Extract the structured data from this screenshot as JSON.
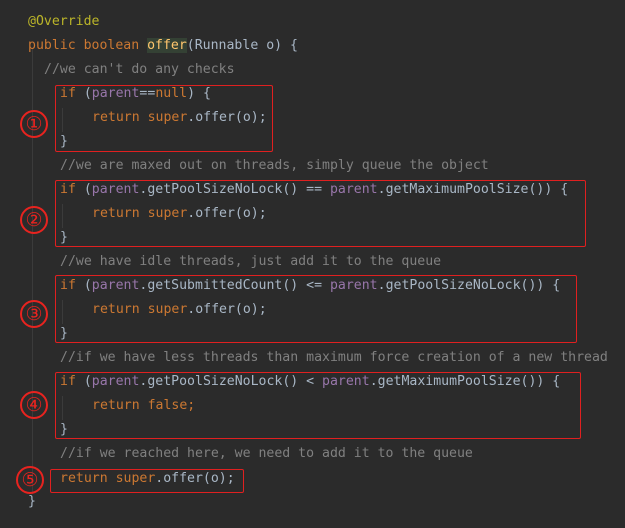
{
  "code": {
    "annotation": "@Override",
    "signature": {
      "modifiers": "public boolean ",
      "method": "offer",
      "params": "(Runnable o) {"
    },
    "block1": {
      "comment": "//we can't do any checks",
      "if_kw": "if",
      "cond": " (",
      "field": "parent",
      "rest": "==",
      "null_kw": "null",
      "close": ") {",
      "ret_kw": "return ",
      "super_kw": "super",
      "ret_rest": ".offer(o);",
      "brace": "}"
    },
    "block2": {
      "comment": "//we are maxed out on threads, simply queue the object",
      "if_kw": "if",
      "open": " (",
      "field1": "parent",
      "call1": ".getPoolSizeNoLock() == ",
      "field2": "parent",
      "call2": ".getMaximumPoolSize()) {",
      "ret_kw": "return ",
      "super_kw": "super",
      "ret_rest": ".offer(o);",
      "brace": "}"
    },
    "block3": {
      "comment": "//we have idle threads, just add it to the queue",
      "if_kw": "if",
      "open": " (",
      "field1": "parent",
      "call1": ".getSubmittedCount() <= ",
      "field2": "parent",
      "call2": ".getPoolSizeNoLock()) {",
      "ret_kw": "return ",
      "super_kw": "super",
      "ret_rest": ".offer(o);",
      "brace": "}"
    },
    "block4": {
      "comment": "//if we have less threads than maximum force creation of a new thread",
      "if_kw": "if",
      "open": " (",
      "field1": "parent",
      "call1": ".getPoolSizeNoLock() < ",
      "field2": "parent",
      "call2": ".getMaximumPoolSize()) {",
      "ret_kw": "return ",
      "false_kw": "false",
      "semi": ";",
      "brace": "}"
    },
    "block5": {
      "comment": "//if we reached here, we need to add it to the queue",
      "ret_kw": "return ",
      "super_kw": "super",
      "ret_rest": ".offer(o);"
    },
    "closing_brace": "}"
  },
  "markers": [
    "①",
    "②",
    "③",
    "④",
    "⑤"
  ],
  "colors": {
    "background": "#2b2b2b",
    "keyword": "#cc7832",
    "annotation": "#bbb529",
    "method_highlight": "#ffc66d",
    "field": "#9876aa",
    "comment": "#808080",
    "text": "#a9b7c6",
    "highlight_box": "#e02020"
  }
}
